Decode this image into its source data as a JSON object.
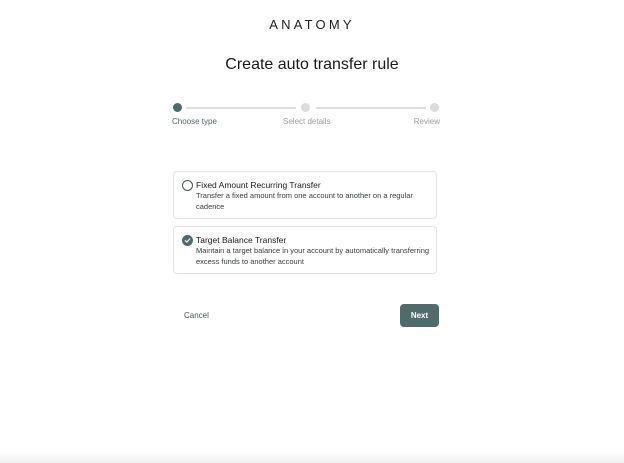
{
  "brand": {
    "logo_text": "ANATOMY"
  },
  "page": {
    "title": "Create auto transfer rule"
  },
  "stepper": {
    "steps": [
      {
        "label": "Choose type",
        "state": "active"
      },
      {
        "label": "Select details",
        "state": "inactive"
      },
      {
        "label": "Review",
        "state": "inactive"
      }
    ]
  },
  "options": [
    {
      "title": "Fixed Amount Recurring Transfer",
      "description": "Transfer a fixed amount from one account to another on a regular cadence",
      "selected": false
    },
    {
      "title": "Target Balance Transfer",
      "description": "Maintain a target balance in your account by automatically transferring excess funds to another account",
      "selected": true
    }
  ],
  "actions": {
    "cancel_label": "Cancel",
    "next_label": "Next"
  },
  "colors": {
    "accent": "#4f6b6b",
    "muted": "#9a9f9f",
    "border": "#e2e4e4"
  }
}
